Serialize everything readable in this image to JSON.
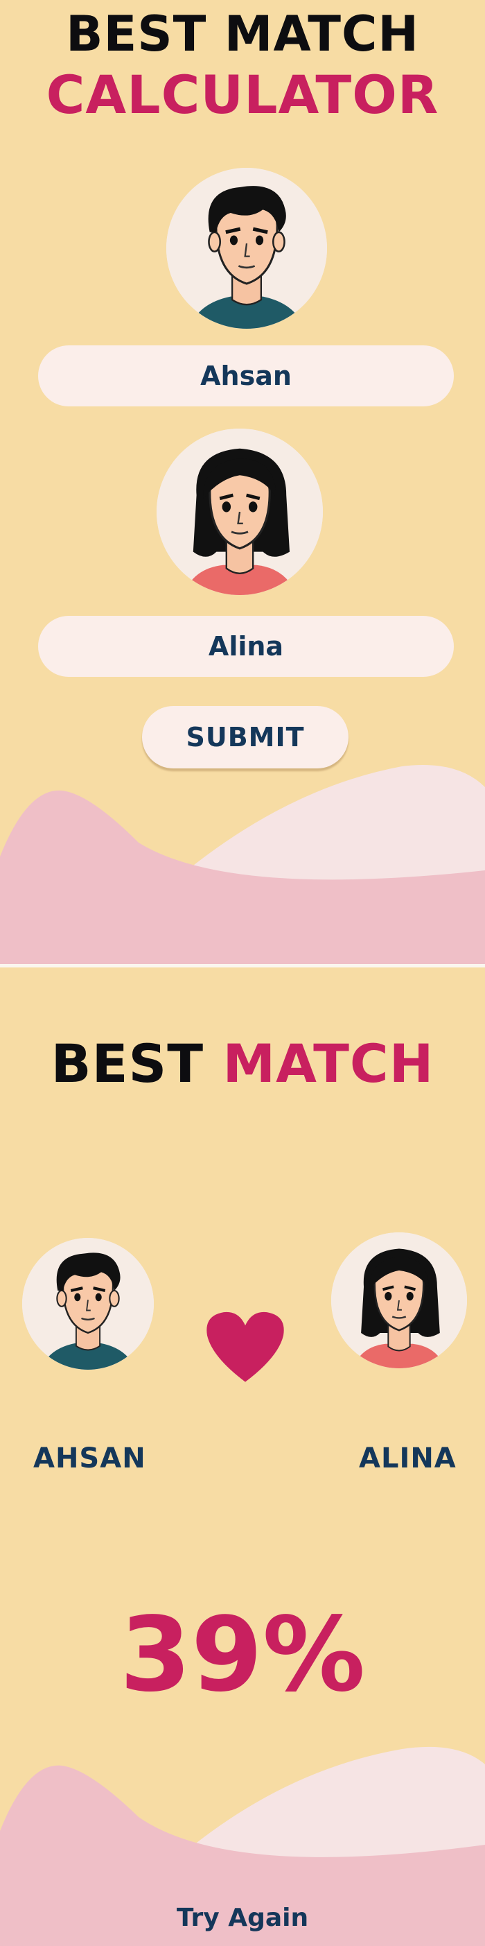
{
  "calculator": {
    "title_line1": "BEST MATCH",
    "title_line2": "CALCULATOR",
    "person1": {
      "name": "Ahsan",
      "avatar": "male-avatar-icon"
    },
    "person2": {
      "name": "Alina",
      "avatar": "female-avatar-icon"
    },
    "submit_label": "SUBMIT"
  },
  "result": {
    "title_word1": "BEST",
    "title_word2": "MATCH",
    "person1_name": "AHSAN",
    "person2_name": "ALINA",
    "heart_icon": "heart-icon",
    "percent_text": "39%",
    "match_percent": 39,
    "try_again_label": "Try Again"
  },
  "colors": {
    "background": "#f7dca4",
    "accent_pink": "#c8205f",
    "navy": "#14375a",
    "pill": "#fbeeea",
    "wave_pink": "#efbfc7",
    "wave_light": "#f6e4e4"
  }
}
